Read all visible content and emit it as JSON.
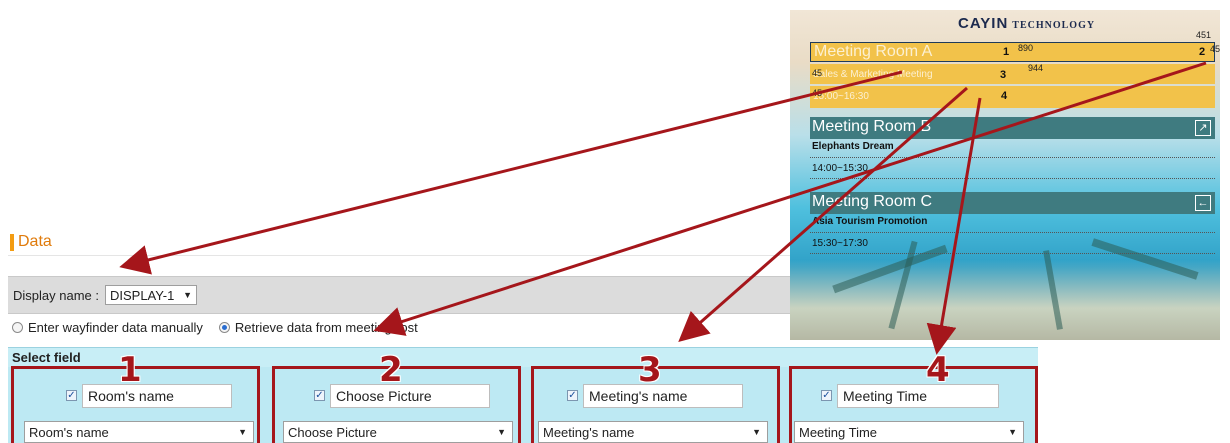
{
  "section": {
    "title": "Data"
  },
  "display": {
    "label": "Display name :",
    "value": "DISPLAY-1"
  },
  "radios": [
    {
      "label": "Enter wayfinder data manually",
      "selected": false
    },
    {
      "label": "Retrieve data from meetingPost",
      "selected": true
    }
  ],
  "select_field": {
    "title": "Select field",
    "columns": [
      {
        "number": "1",
        "label": "Room's name",
        "checked": true,
        "dropdown": "Room's name"
      },
      {
        "number": "2",
        "label": "Choose Picture",
        "checked": true,
        "dropdown": "Choose Picture"
      },
      {
        "number": "3",
        "label": "Meeting's name",
        "checked": true,
        "dropdown": "Meeting's name"
      },
      {
        "number": "4",
        "label": "Meeting Time",
        "checked": true,
        "dropdown": "Meeting Time"
      }
    ]
  },
  "preview": {
    "brand_main": "CAYIN",
    "brand_sub": "TECHNOLOGY",
    "room_a": {
      "name": "Meeting Room A",
      "meeting": "Sales & Marketing Meeting",
      "time": "15:00~16:30"
    },
    "markers": [
      "1",
      "2",
      "3",
      "4"
    ],
    "dims": {
      "w1": "890",
      "w2": "944",
      "h1": "45",
      "h2": "45",
      "h3": "45",
      "top": "451",
      "right": "45"
    },
    "rooms": [
      {
        "name": "Meeting Room B",
        "meeting": "Elephants Dream",
        "time": "14:00~15:30",
        "icon": "arrow-up-right-icon"
      },
      {
        "name": "Meeting Room C",
        "meeting": "Asia Tourism Promotion",
        "time": "15:30~17:30",
        "icon": "arrow-left-icon"
      }
    ]
  },
  "colors": {
    "accent": "#a5161b",
    "heading": "#e07b0c",
    "field_bg": "#bde9f3",
    "highlight": "#f2c24a"
  }
}
